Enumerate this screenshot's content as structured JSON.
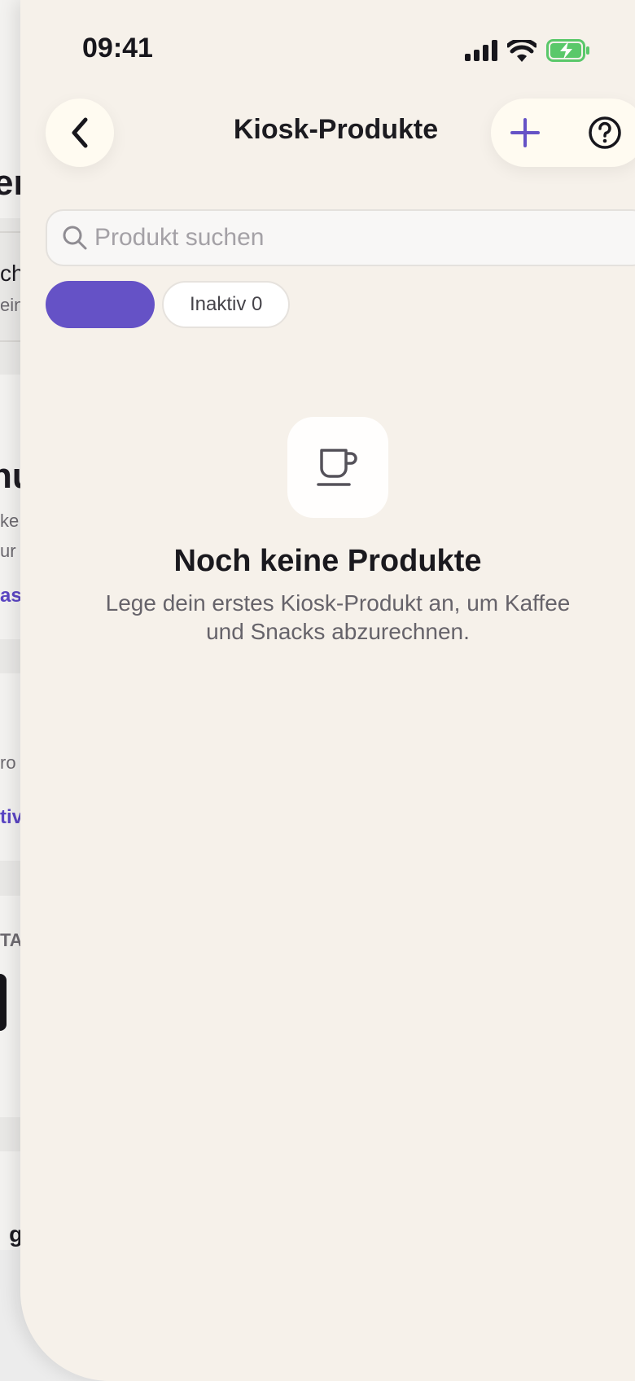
{
  "background_screen": {
    "fragments": [
      "er",
      "ch",
      "ein",
      "nu",
      "ke",
      "ur",
      "ase",
      "ro",
      "tiv",
      "TA",
      "· g"
    ]
  },
  "status_bar": {
    "time": "09:41",
    "icons": [
      "signal-icon",
      "wifi-icon",
      "battery-charging-icon"
    ]
  },
  "header": {
    "title": "Kiosk-Produkte",
    "back_icon": "chevron-left-icon",
    "add_icon": "plus-icon",
    "help_icon": "help-circle-icon"
  },
  "search": {
    "placeholder": "Produkt suchen",
    "value": ""
  },
  "filters": {
    "active_chip_label": "",
    "inactive_chip_label": "Inaktiv 0"
  },
  "empty_state": {
    "icon": "coffee-cup-icon",
    "title": "Noch keine Produkte",
    "description": "Lege dein erstes Kiosk-Produkt an, um Kaffee und Snacks abzurechnen."
  },
  "colors": {
    "accent": "#6552c6",
    "sheet_background": "#f6f1ea",
    "button_background": "#fffbf1"
  }
}
